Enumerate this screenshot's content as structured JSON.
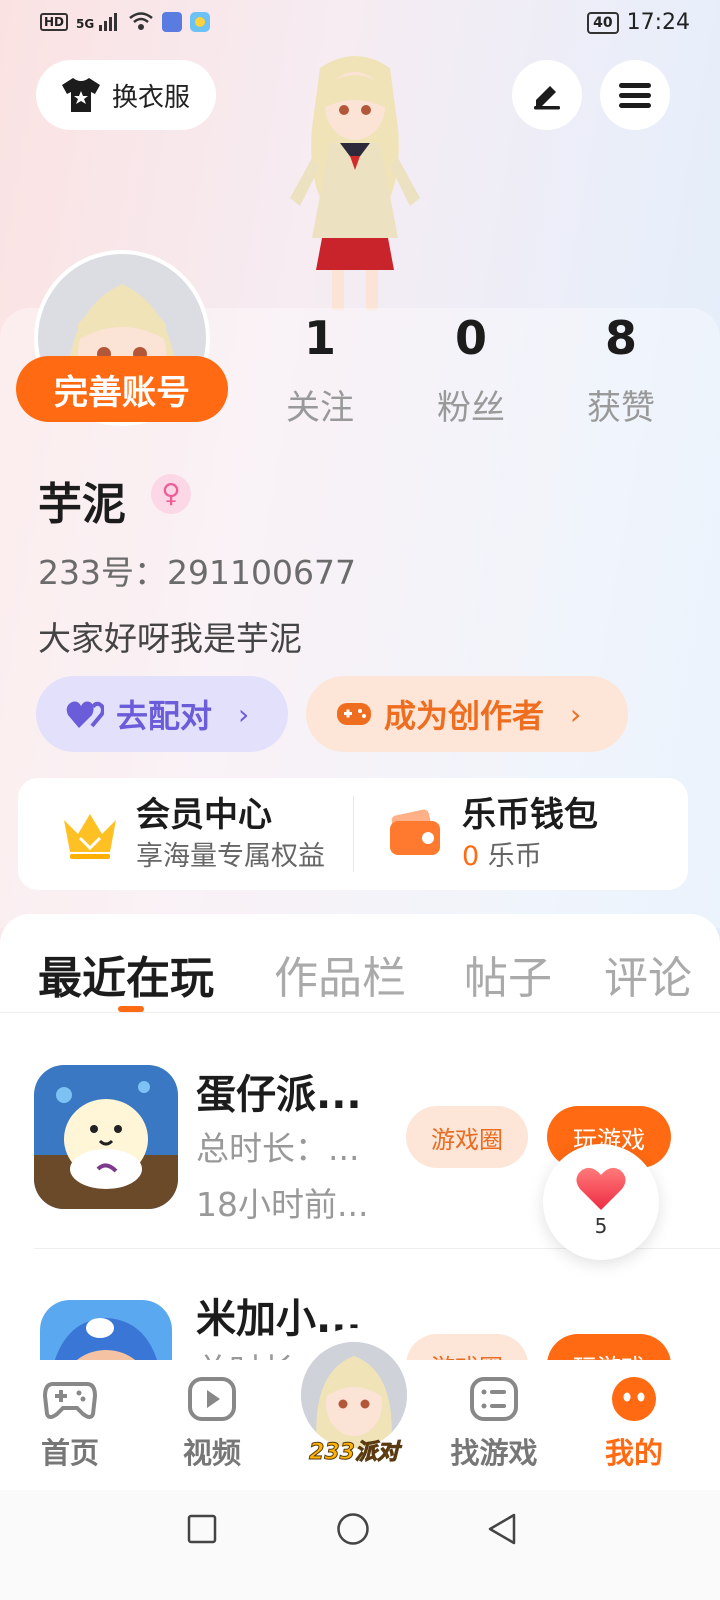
{
  "status_bar": {
    "hd": "HD",
    "signal": "5G",
    "battery": "40",
    "time": "17:24"
  },
  "header": {
    "outfit_label": "换衣服"
  },
  "profile": {
    "complete_label": "完善账号",
    "stats": [
      {
        "value": "1",
        "label": "关注"
      },
      {
        "value": "0",
        "label": "粉丝"
      },
      {
        "value": "8",
        "label": "获赞"
      }
    ],
    "nickname": "芋泥",
    "gender_symbol": "♀",
    "uid": "233号：291100677",
    "bio": "大家好呀我是芋泥",
    "pair_label": "去配对",
    "creator_label": "成为创作者",
    "chevron": "›"
  },
  "vip": {
    "title": "会员中心",
    "subtitle": "享海量专属权益",
    "wallet_title": "乐币钱包",
    "coin_count": "0",
    "coin_unit": "乐币"
  },
  "tabs": [
    "最近在玩",
    "作品栏",
    "帖子",
    "评论"
  ],
  "games": [
    {
      "name": "蛋仔派...",
      "duration": "总时长：...",
      "last_played": "18小时前...",
      "circle_label": "游戏圈",
      "play_label": "玩游戏"
    },
    {
      "name": "米加小...",
      "duration": "总时长：...",
      "circle_label": "游戏圈",
      "play_label": "玩游戏"
    }
  ],
  "like_float": {
    "count": "5"
  },
  "bottom_nav": [
    {
      "label": "首页",
      "icon": "gamepad-icon"
    },
    {
      "label": "视频",
      "icon": "video-icon"
    },
    {
      "label": "233派对",
      "icon": "party-avatar"
    },
    {
      "label": "找游戏",
      "icon": "list-icon"
    },
    {
      "label": "我的",
      "icon": "profile-icon"
    }
  ],
  "colors": {
    "accent": "#ff6a12",
    "purple": "#6b5cd9"
  }
}
